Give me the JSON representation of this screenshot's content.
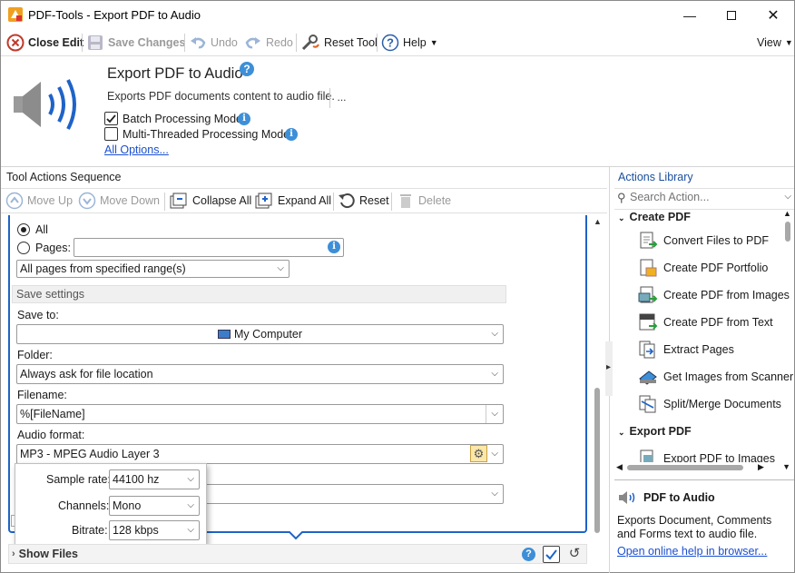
{
  "window": {
    "title": "PDF-Tools - Export PDF to Audio"
  },
  "toolbar": {
    "close_edit": "Close Edit",
    "save_changes": "Save Changes",
    "undo": "Undo",
    "redo": "Redo",
    "reset_tool": "Reset Tool",
    "help": "Help",
    "view": "View"
  },
  "header": {
    "title": "Export PDF to Audio",
    "description": "Exports PDF documents content to audio file.",
    "more": "...",
    "batch_mode": "Batch Processing Mode",
    "batch_checked": true,
    "multi_thread": "Multi-Threaded Processing Mode",
    "multi_checked": false,
    "all_options": "All Options..."
  },
  "sequence": {
    "title": "Tool Actions Sequence",
    "move_up": "Move Up",
    "move_down": "Move Down",
    "collapse_all": "Collapse All",
    "expand_all": "Expand All",
    "reset": "Reset",
    "delete": "Delete",
    "pages": {
      "all": "All",
      "pages": "Pages:",
      "pages_value": "",
      "range_select": "All pages from specified range(s)"
    },
    "save_settings": {
      "heading": "Save settings",
      "save_to_label": "Save to:",
      "save_to_value": "My Computer",
      "folder_label": "Folder:",
      "folder_value": "Always ask for file location",
      "filename_label": "Filename:",
      "filename_value": "%[FileName]",
      "audio_format_label": "Audio format:",
      "audio_format_value": "MP3 - MPEG Audio Layer 3"
    },
    "popup": {
      "sample_rate_label": "Sample rate:",
      "sample_rate_value": "44100 hz",
      "channels_label": "Channels:",
      "channels_value": "Mono",
      "bitrate_label": "Bitrate:",
      "bitrate_value": "128 kbps"
    },
    "show_files": "Show Files"
  },
  "library": {
    "title": "Actions Library",
    "search_placeholder": "Search Action...",
    "group1": "Create PDF",
    "items": [
      "Convert Files to PDF",
      "Create PDF Portfolio",
      "Create PDF from Images",
      "Create PDF from Text",
      "Extract Pages",
      "Get Images from Scanner",
      "Split/Merge Documents"
    ],
    "group2": "Export PDF",
    "item_partial": "Export PDF to Images",
    "info_title": "PDF to Audio",
    "info_desc": "Exports Document, Comments and Forms text to audio file.",
    "info_link": "Open online help in browser..."
  },
  "colors": {
    "accent": "#1e63c8",
    "link": "#1a4fd0",
    "info": "#3d8fd8"
  }
}
